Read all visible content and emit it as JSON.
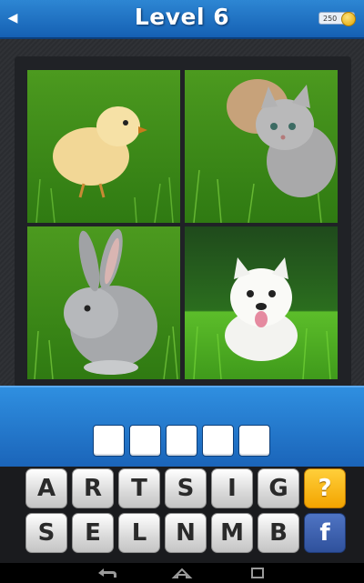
{
  "header": {
    "back_icon": "back-arrow-icon",
    "title": "Level 6",
    "coins_value": "250",
    "coin_icon": "coin-icon"
  },
  "photos": [
    {
      "subject": "chick-photo"
    },
    {
      "subject": "kitten-photo"
    },
    {
      "subject": "rabbit-photo"
    },
    {
      "subject": "puppy-photo"
    }
  ],
  "answer": {
    "slots": [
      "",
      "",
      "",
      "",
      ""
    ]
  },
  "keyboard": {
    "row1": [
      "A",
      "R",
      "T",
      "S",
      "I",
      "G"
    ],
    "hint_label": "?",
    "row2": [
      "S",
      "E",
      "L",
      "N",
      "M",
      "B"
    ],
    "facebook_label": "f"
  },
  "colors": {
    "header_blue": "#1a6fc4",
    "hint_orange": "#f3a400",
    "facebook_blue": "#3b5998"
  },
  "navbar": {
    "icons": [
      "back-icon",
      "home-icon",
      "recent-apps-icon"
    ]
  }
}
